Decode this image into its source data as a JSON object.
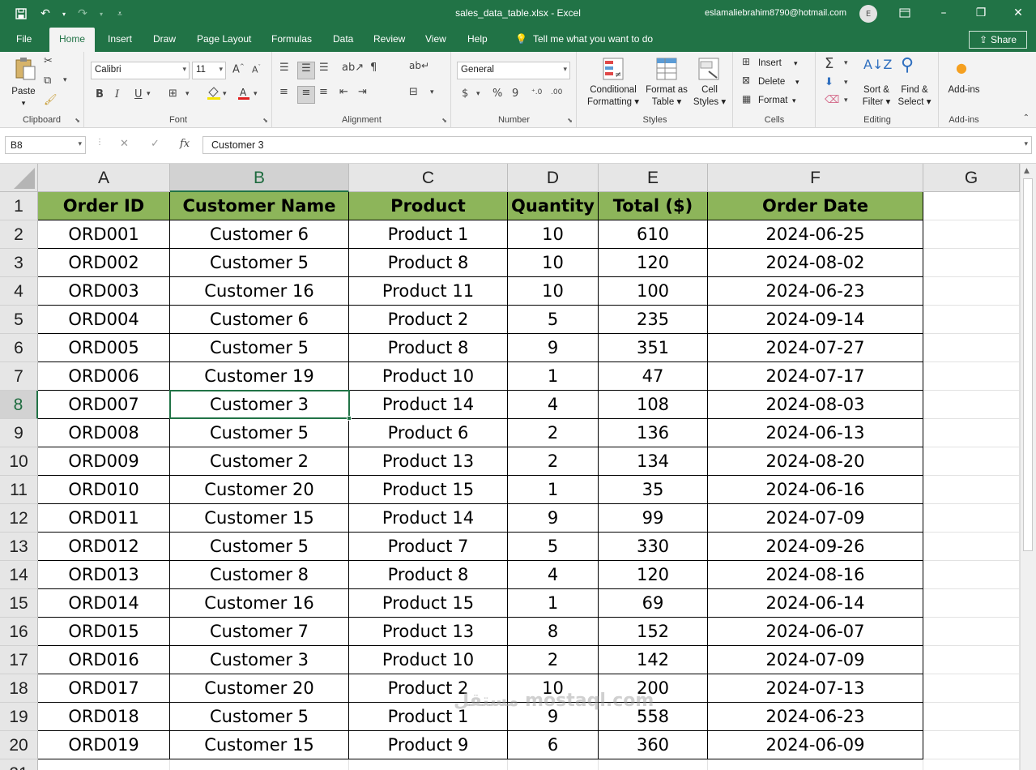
{
  "window": {
    "title": "sales_data_table.xlsx  -  Excel",
    "user_email": "eslamaliebrahim8790@hotmail.com",
    "avatar_initial": "E"
  },
  "ribbon_tabs": [
    "File",
    "Home",
    "Insert",
    "Draw",
    "Page Layout",
    "Formulas",
    "Data",
    "Review",
    "View",
    "Help"
  ],
  "tell_me": "Tell me what you want to do",
  "share_label": "Share",
  "ribbon": {
    "clipboard": {
      "label": "Clipboard",
      "paste": "Paste"
    },
    "font": {
      "label": "Font",
      "font_name": "Calibri",
      "font_size": "11",
      "bold": "B",
      "italic": "I",
      "underline": "U"
    },
    "alignment": {
      "label": "Alignment"
    },
    "number": {
      "label": "Number",
      "format": "General",
      "currency": "$",
      "percent": "%",
      "comma": "9"
    },
    "styles": {
      "label": "Styles",
      "conditional": "Conditional",
      "formatting": "Formatting",
      "format_as": "Format as",
      "table": "Table",
      "cell": "Cell",
      "cell_styles": "Styles"
    },
    "cells": {
      "label": "Cells",
      "insert": "Insert",
      "delete": "Delete",
      "format": "Format"
    },
    "editing": {
      "label": "Editing",
      "sort": "Sort &",
      "filter": "Filter",
      "find": "Find &",
      "select": "Select"
    },
    "addins": {
      "label": "Add-ins",
      "addins": "Add-ins"
    }
  },
  "formula_bar": {
    "name_box": "B8",
    "fx": "fx",
    "content": "Customer 3"
  },
  "sheet": {
    "columns": [
      "A",
      "B",
      "C",
      "D",
      "E",
      "F",
      "G"
    ],
    "selected_column": "B",
    "selected_row": 8,
    "headers": [
      "Order ID",
      "Customer Name",
      "Product",
      "Quantity",
      "Total ($)",
      "Order Date"
    ],
    "rows": [
      [
        "ORD001",
        "Customer 6",
        "Product 1",
        "10",
        "610",
        "2024-06-25"
      ],
      [
        "ORD002",
        "Customer 5",
        "Product 8",
        "10",
        "120",
        "2024-08-02"
      ],
      [
        "ORD003",
        "Customer 16",
        "Product 11",
        "10",
        "100",
        "2024-06-23"
      ],
      [
        "ORD004",
        "Customer 6",
        "Product 2",
        "5",
        "235",
        "2024-09-14"
      ],
      [
        "ORD005",
        "Customer 5",
        "Product 8",
        "9",
        "351",
        "2024-07-27"
      ],
      [
        "ORD006",
        "Customer 19",
        "Product 10",
        "1",
        "47",
        "2024-07-17"
      ],
      [
        "ORD007",
        "Customer 3",
        "Product 14",
        "4",
        "108",
        "2024-08-03"
      ],
      [
        "ORD008",
        "Customer 5",
        "Product 6",
        "2",
        "136",
        "2024-06-13"
      ],
      [
        "ORD009",
        "Customer 2",
        "Product 13",
        "2",
        "134",
        "2024-08-20"
      ],
      [
        "ORD010",
        "Customer 20",
        "Product 15",
        "1",
        "35",
        "2024-06-16"
      ],
      [
        "ORD011",
        "Customer 15",
        "Product 14",
        "9",
        "99",
        "2024-07-09"
      ],
      [
        "ORD012",
        "Customer 5",
        "Product 7",
        "5",
        "330",
        "2024-09-26"
      ],
      [
        "ORD013",
        "Customer 8",
        "Product 8",
        "4",
        "120",
        "2024-08-16"
      ],
      [
        "ORD014",
        "Customer 16",
        "Product 15",
        "1",
        "69",
        "2024-06-14"
      ],
      [
        "ORD015",
        "Customer 7",
        "Product 13",
        "8",
        "152",
        "2024-06-07"
      ],
      [
        "ORD016",
        "Customer 3",
        "Product 10",
        "2",
        "142",
        "2024-07-09"
      ],
      [
        "ORD017",
        "Customer 20",
        "Product 2",
        "10",
        "200",
        "2024-07-13"
      ],
      [
        "ORD018",
        "Customer 5",
        "Product 1",
        "9",
        "558",
        "2024-06-23"
      ],
      [
        "ORD019",
        "Customer 15",
        "Product 9",
        "6",
        "360",
        "2024-06-09"
      ]
    ]
  },
  "watermark": "مستقل mostaql.com",
  "colors": {
    "accent": "#217346",
    "header_fill": "#8db55a"
  }
}
